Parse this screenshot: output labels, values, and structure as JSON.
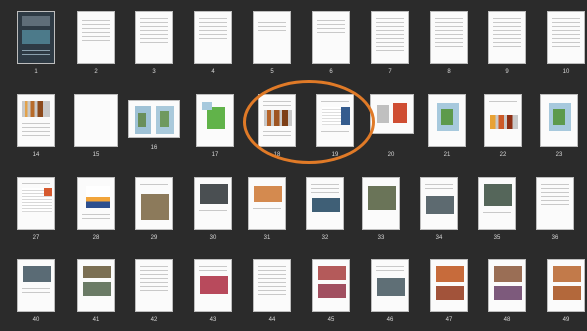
{
  "thumbnails": [
    {
      "label": "1"
    },
    {
      "label": "2"
    },
    {
      "label": "3"
    },
    {
      "label": "4"
    },
    {
      "label": "5"
    },
    {
      "label": "6"
    },
    {
      "label": "7"
    },
    {
      "label": "8"
    },
    {
      "label": "9"
    },
    {
      "label": "10"
    },
    {
      "label": "14"
    },
    {
      "label": "15"
    },
    {
      "label": "16"
    },
    {
      "label": "17"
    },
    {
      "label": "18"
    },
    {
      "label": "19"
    },
    {
      "label": "20"
    },
    {
      "label": "21"
    },
    {
      "label": "22"
    },
    {
      "label": "23"
    },
    {
      "label": "27"
    },
    {
      "label": "28"
    },
    {
      "label": "29"
    },
    {
      "label": "30"
    },
    {
      "label": "31"
    },
    {
      "label": "32"
    },
    {
      "label": "33"
    },
    {
      "label": "34"
    },
    {
      "label": "35"
    },
    {
      "label": "36"
    },
    {
      "label": "40"
    },
    {
      "label": "41"
    },
    {
      "label": "42"
    },
    {
      "label": "43"
    },
    {
      "label": "44"
    },
    {
      "label": "45"
    },
    {
      "label": "46"
    },
    {
      "label": "47"
    },
    {
      "label": "48"
    },
    {
      "label": "49"
    }
  ],
  "highlight": {
    "color": "#e07a27",
    "pages": [
      "18",
      "19"
    ]
  }
}
